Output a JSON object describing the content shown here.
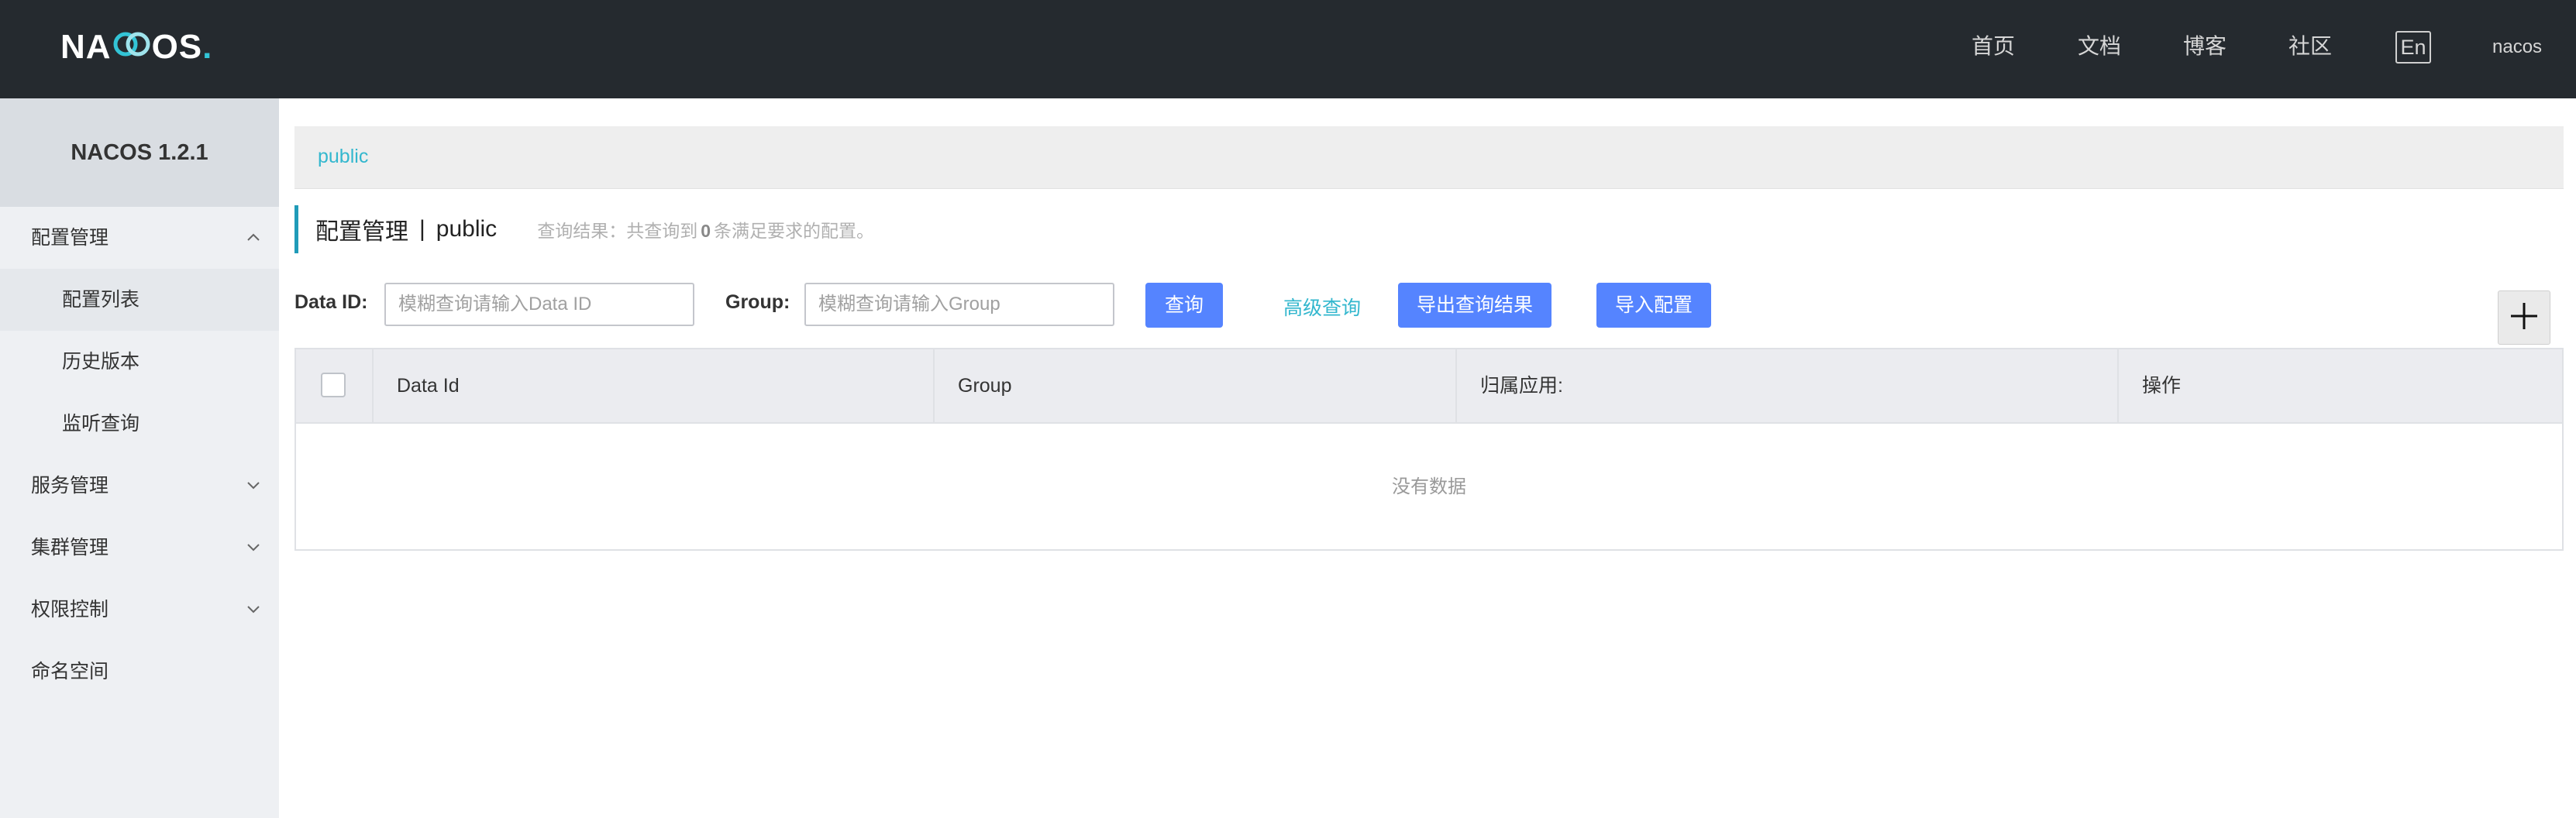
{
  "header": {
    "logo": {
      "left": "NA",
      "ring": "C",
      "right": "OS",
      "dot": "."
    },
    "nav": [
      {
        "label": "首页"
      },
      {
        "label": "文档"
      },
      {
        "label": "博客"
      },
      {
        "label": "社区"
      }
    ],
    "lang_button": "En",
    "user": "nacos"
  },
  "sidebar": {
    "title": "NACOS 1.2.1",
    "items": [
      {
        "label": "配置管理",
        "expanded": true,
        "icon": "chevron-up-icon"
      },
      {
        "label": "配置列表",
        "active": true
      },
      {
        "label": "历史版本"
      },
      {
        "label": "监听查询"
      },
      {
        "label": "服务管理",
        "icon": "chevron-down-icon"
      },
      {
        "label": "集群管理",
        "icon": "chevron-down-icon"
      },
      {
        "label": "权限控制",
        "icon": "chevron-down-icon"
      },
      {
        "label": "命名空间"
      }
    ]
  },
  "namespace_bar": {
    "current": "public"
  },
  "page": {
    "title": "配置管理",
    "separator": "|",
    "namespace": "public",
    "result_prefix": "查询结果：共查询到",
    "result_count": "0",
    "result_suffix": "条满足要求的配置。"
  },
  "filters": {
    "data_id_label": "Data ID:",
    "data_id_value": "",
    "data_id_placeholder": "模糊查询请输入Data ID",
    "group_label": "Group:",
    "group_value": "",
    "group_placeholder": "模糊查询请输入Group",
    "query_button": "查询",
    "advanced_link": "高级查询",
    "export_button": "导出查询结果",
    "import_button": "导入配置"
  },
  "table": {
    "columns": [
      "Data Id",
      "Group",
      "归属应用:",
      "操作"
    ],
    "rows": [],
    "empty_text": "没有数据"
  },
  "colors": {
    "header_bg": "#252a2f",
    "primary": "#5584ff",
    "accent": "#33b7ce",
    "sidebar_bg": "#eef0f3"
  }
}
